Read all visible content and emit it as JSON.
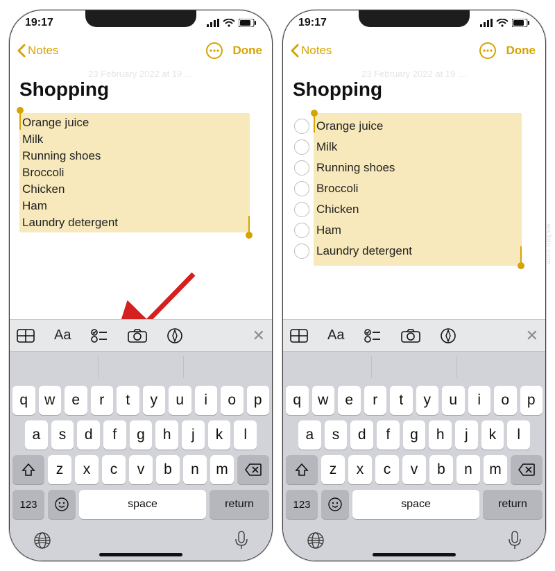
{
  "status": {
    "time": "19:17"
  },
  "nav": {
    "back_label": "Notes",
    "done_label": "Done"
  },
  "note": {
    "ghost_date": "23 February 2022 at 19 …",
    "title": "Shopping",
    "items": [
      "Orange juice",
      "Milk",
      "Running shoes",
      "Broccoli",
      "Chicken",
      "Ham",
      "Laundry detergent"
    ]
  },
  "format_bar": {
    "table_icon": "table-icon",
    "text_style_label": "Aa",
    "checklist_icon": "checklist-icon",
    "camera_icon": "camera-icon",
    "markup_icon": "markup-icon",
    "close_icon": "close-icon"
  },
  "keyboard": {
    "row1": [
      "q",
      "w",
      "e",
      "r",
      "t",
      "y",
      "u",
      "i",
      "o",
      "p"
    ],
    "row2": [
      "a",
      "s",
      "d",
      "f",
      "g",
      "h",
      "j",
      "k",
      "l"
    ],
    "row3": [
      "z",
      "x",
      "c",
      "v",
      "b",
      "n",
      "m"
    ],
    "numbers_label": "123",
    "space_label": "space",
    "return_label": "return"
  },
  "watermark": "ws3dn.com"
}
